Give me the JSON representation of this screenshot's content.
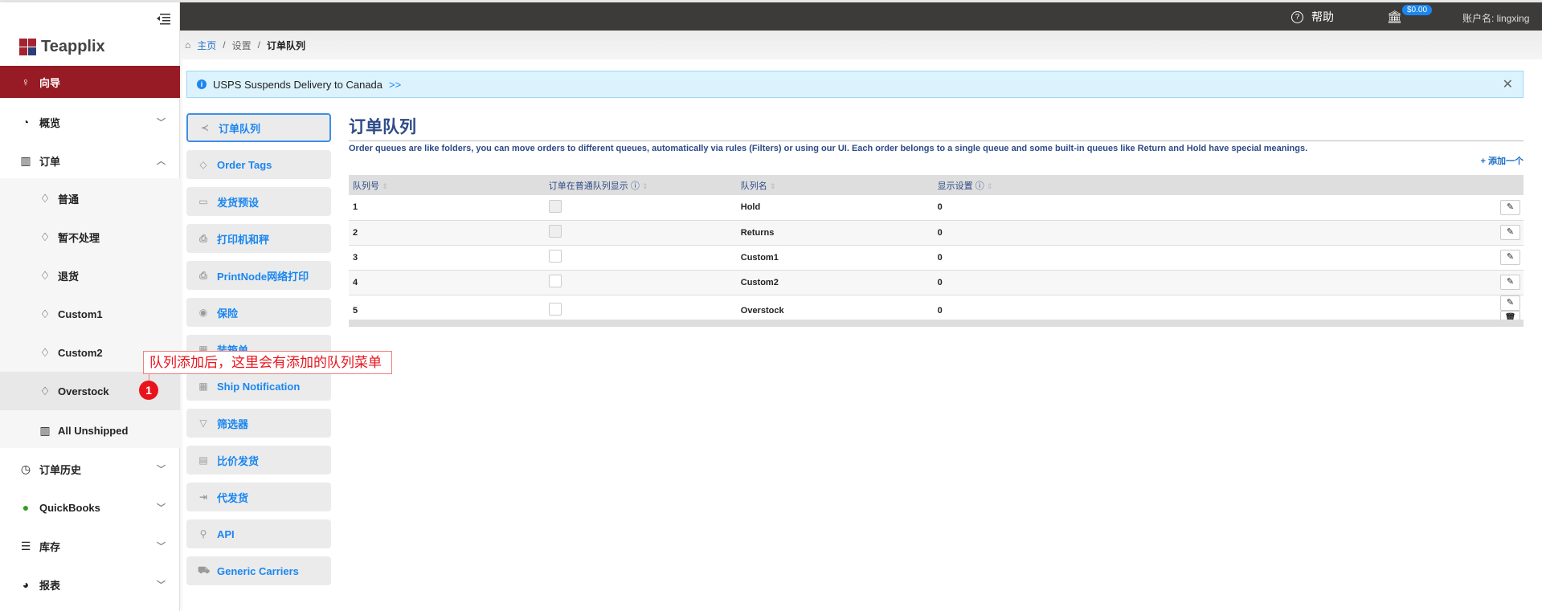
{
  "topbar": {
    "help": "帮助",
    "balance": "$0.00",
    "account": "账户名: lingxing"
  },
  "sidebar": {
    "logo": "Teapplix",
    "items": [
      {
        "label": "向导",
        "icon": "lightbulb-icon",
        "active": true
      },
      {
        "label": "概览",
        "icon": "dashboard-icon",
        "chevron": "down"
      },
      {
        "label": "订单",
        "icon": "barcode-icon",
        "chevron": "up"
      },
      {
        "label": "普通",
        "icon": "bell-icon",
        "sub": true
      },
      {
        "label": "暂不处理",
        "icon": "bell-icon",
        "sub": true
      },
      {
        "label": "退货",
        "icon": "bell-icon",
        "sub": true
      },
      {
        "label": "Custom1",
        "icon": "bell-icon",
        "sub": true
      },
      {
        "label": "Custom2",
        "icon": "bell-icon",
        "sub": true
      },
      {
        "label": "Overstock",
        "icon": "bell-icon",
        "sub": true,
        "highlight": true
      },
      {
        "label": "All Unshipped",
        "icon": "barcode-icon",
        "sub": true
      },
      {
        "label": "订单历史",
        "icon": "clock-icon",
        "chevron": "down"
      },
      {
        "label": "QuickBooks",
        "icon": "quickbooks-icon",
        "chevron": "down"
      },
      {
        "label": "库存",
        "icon": "list-icon",
        "chevron": "down"
      },
      {
        "label": "报表",
        "icon": "pie-chart-icon",
        "chevron": "down"
      }
    ]
  },
  "breadcrumb": {
    "home": "主页",
    "settings": "设置",
    "current": "订单队列"
  },
  "alert": {
    "text": "USPS Suspends Delivery to Canada",
    "link": ">>"
  },
  "settings_nav": [
    {
      "label": "订单队列",
      "icon": "share-icon",
      "selected": true
    },
    {
      "label": "Order Tags",
      "icon": "tag-icon"
    },
    {
      "label": "发货预设",
      "icon": "calendar-icon"
    },
    {
      "label": "打印机和秤",
      "icon": "printer-icon"
    },
    {
      "label": "PrintNode网络打印",
      "icon": "printer-icon"
    },
    {
      "label": "保险",
      "icon": "eye-icon"
    },
    {
      "label": "装箱单",
      "icon": "grid-icon"
    },
    {
      "label": "Ship Notification",
      "icon": "grid-icon"
    },
    {
      "label": "筛选器",
      "icon": "filter-icon"
    },
    {
      "label": "比价发货",
      "icon": "store-icon"
    },
    {
      "label": "代发货",
      "icon": "export-icon"
    },
    {
      "label": "API",
      "icon": "plug-icon"
    },
    {
      "label": "Generic Carriers",
      "icon": "truck-icon"
    }
  ],
  "main": {
    "title": "订单队列",
    "description": "Order queues are like folders, you can move orders to different queues, automatically via rules (Filters) or using our UI. Each order belongs to a single queue and some built-in queues like Return and Hold have special meanings.",
    "add": "+ 添加一个",
    "columns": [
      "队列号",
      "订单在普通队列显示",
      "队列名",
      "显示设置"
    ],
    "rows": [
      {
        "id": "1",
        "checked": false,
        "disabled": true,
        "name": "Hold",
        "display": "0",
        "delete": false
      },
      {
        "id": "2",
        "checked": false,
        "disabled": true,
        "name": "Returns",
        "display": "0",
        "delete": false
      },
      {
        "id": "3",
        "checked": false,
        "disabled": false,
        "name": "Custom1",
        "display": "0",
        "delete": false
      },
      {
        "id": "4",
        "checked": false,
        "disabled": false,
        "name": "Custom2",
        "display": "0",
        "delete": false
      },
      {
        "id": "5",
        "checked": false,
        "disabled": false,
        "name": "Overstock",
        "display": "0",
        "delete": true
      }
    ]
  },
  "annotation": {
    "text": "队列添加后，这里会有添加的队列菜单",
    "badge": "1"
  },
  "colors": {
    "brand": "#971b24",
    "accent": "#1a86f0",
    "annotation": "#e8141c"
  }
}
